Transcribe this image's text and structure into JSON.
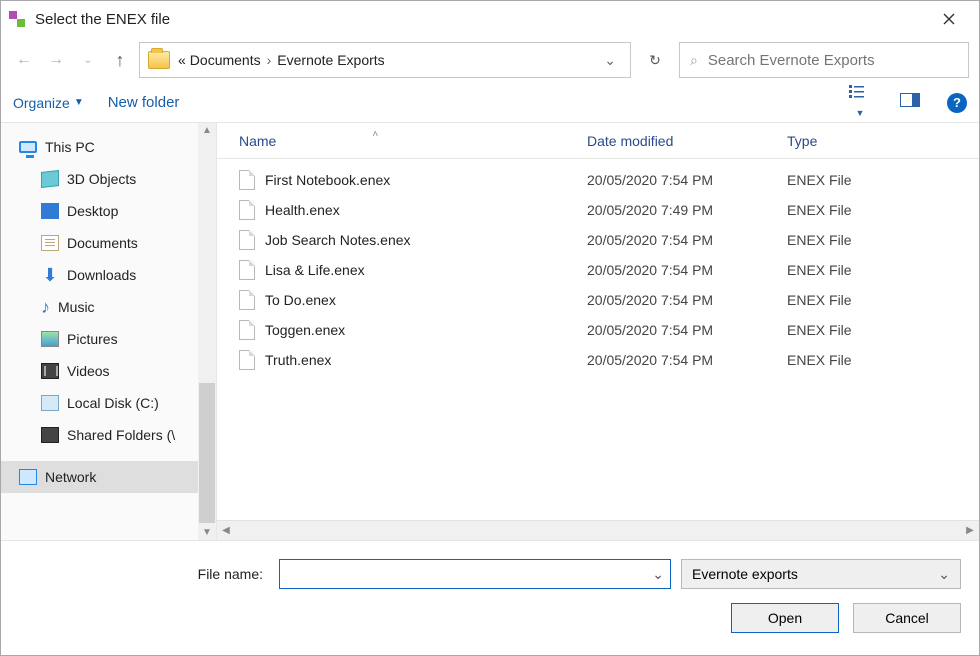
{
  "window": {
    "title": "Select the ENEX file"
  },
  "breadcrumbs": {
    "prefix": "«",
    "seg1": "Documents",
    "seg2": "Evernote Exports"
  },
  "search": {
    "placeholder": "Search Evernote Exports"
  },
  "toolbar": {
    "organize": "Organize",
    "newfolder": "New folder"
  },
  "columns": {
    "name": "Name",
    "date": "Date modified",
    "type": "Type"
  },
  "nav": {
    "thispc": "This PC",
    "items": [
      {
        "label": "3D Objects"
      },
      {
        "label": "Desktop"
      },
      {
        "label": "Documents"
      },
      {
        "label": "Downloads"
      },
      {
        "label": "Music"
      },
      {
        "label": "Pictures"
      },
      {
        "label": "Videos"
      },
      {
        "label": "Local Disk (C:)"
      },
      {
        "label": "Shared Folders (\\"
      }
    ],
    "network": "Network"
  },
  "files": [
    {
      "name": "First Notebook.enex",
      "date": "20/05/2020 7:54 PM",
      "type": "ENEX File"
    },
    {
      "name": "Health.enex",
      "date": "20/05/2020 7:49 PM",
      "type": "ENEX File"
    },
    {
      "name": "Job Search Notes.enex",
      "date": "20/05/2020 7:54 PM",
      "type": "ENEX File"
    },
    {
      "name": "Lisa & Life.enex",
      "date": "20/05/2020 7:54 PM",
      "type": "ENEX File"
    },
    {
      "name": "To Do.enex",
      "date": "20/05/2020 7:54 PM",
      "type": "ENEX File"
    },
    {
      "name": "Toggen.enex",
      "date": "20/05/2020 7:54 PM",
      "type": "ENEX File"
    },
    {
      "name": "Truth.enex",
      "date": "20/05/2020 7:54 PM",
      "type": "ENEX File"
    }
  ],
  "footer": {
    "filename_label": "File name:",
    "filename_value": "",
    "filter_label": "Evernote exports",
    "open": "Open",
    "cancel": "Cancel"
  }
}
